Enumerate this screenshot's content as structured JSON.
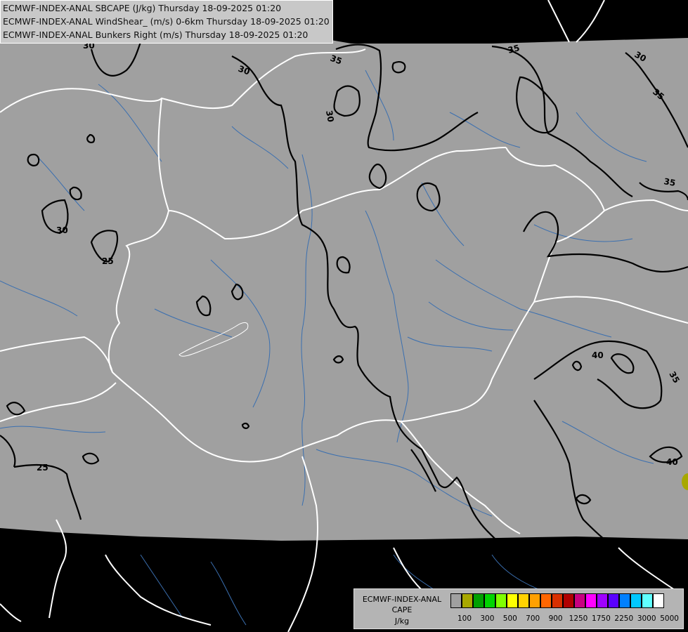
{
  "header": {
    "line1": "ECMWF-INDEX-ANAL SBCAPE (J/kg) Thursday 18-09-2025 01:20",
    "line2": "ECMWF-INDEX-ANAL WindShear_ (m/s) 0-6km Thursday 18-09-2025 01:20",
    "line3": "ECMWF-INDEX-ANAL Bunkers Right (m/s) Thursday 18-09-2025 01:20"
  },
  "contour_labels": [
    "30",
    "35",
    "30",
    "35",
    "30",
    "35",
    "30",
    "30",
    "25",
    "35",
    "40",
    "35",
    "40"
  ],
  "legend": {
    "title_line1": "ECMWF-INDEX-ANAL",
    "title_line2": "CAPE",
    "unit": "J/kg",
    "colors": [
      "#a0a0a0",
      "#a8a800",
      "#00a000",
      "#00d400",
      "#80ff00",
      "#ffff00",
      "#ffd200",
      "#ffa000",
      "#ff6600",
      "#d83000",
      "#b00000",
      "#c80080",
      "#ff00ff",
      "#a000ff",
      "#5a00ff",
      "#0080ff",
      "#00c8ff",
      "#60ffff",
      "#ffffff"
    ],
    "ticks": [
      "100",
      "300",
      "500",
      "700",
      "900",
      "1250",
      "1750",
      "2250",
      "3000",
      "5000"
    ]
  },
  "colors": {
    "outside_domain": "#000000",
    "domain_fill": "#a0a0a0",
    "borders": "#ffffff",
    "rivers": "#3a6fb0",
    "contours": "#000000",
    "cape_100": "#a8a800"
  }
}
